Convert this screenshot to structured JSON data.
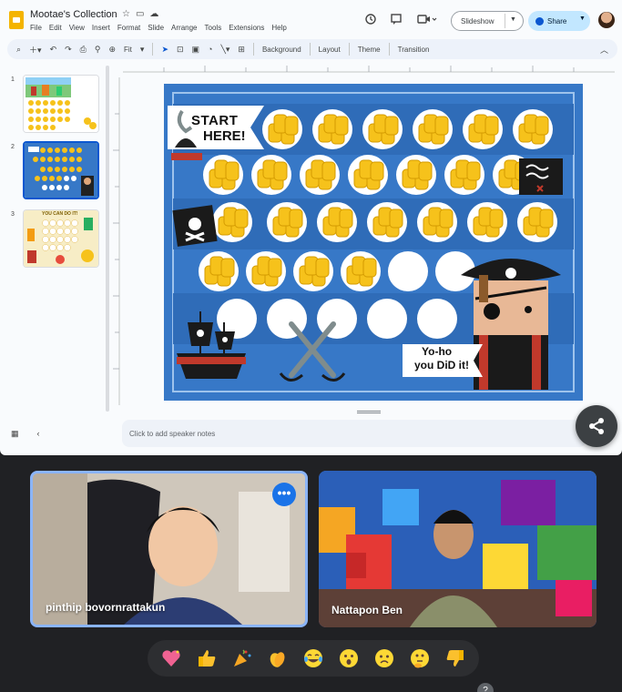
{
  "slides_app": {
    "doc_title": "Mootae's Collection",
    "menu": [
      "File",
      "Edit",
      "View",
      "Insert",
      "Format",
      "Slide",
      "Arrange",
      "Tools",
      "Extensions",
      "Help"
    ],
    "slideshow_label": "Slideshow",
    "share_label": "Share",
    "toolbar": {
      "zoom": "Fit",
      "background_label": "Background",
      "layout_label": "Layout",
      "theme_label": "Theme",
      "transition_label": "Transition"
    },
    "thumbnails": [
      {
        "number": "1"
      },
      {
        "number": "2"
      },
      {
        "number": "3"
      }
    ],
    "thumb3_text": "YOU CAN DO IT!",
    "speaker_notes_placeholder": "Click to add speaker notes"
  },
  "slide": {
    "start_text": "START",
    "here_text": "HERE!",
    "banner_line1": "Yo-ho",
    "banner_line2": "you DiD it!"
  },
  "meet": {
    "participants": [
      {
        "name": "pinthip bovornrattakun"
      },
      {
        "name": "Nattapon Ben"
      }
    ],
    "more_options": "•••",
    "reactions": [
      "sparkling-heart",
      "thumbs-up",
      "party-popper",
      "clapping-hands",
      "tears-of-joy",
      "surprised",
      "sad",
      "thinking",
      "thumbs-down"
    ]
  },
  "colors": {
    "slide_blue": "#3778c7",
    "accent_blue": "#0b57d0",
    "coin_gold": "#f6c21b"
  }
}
